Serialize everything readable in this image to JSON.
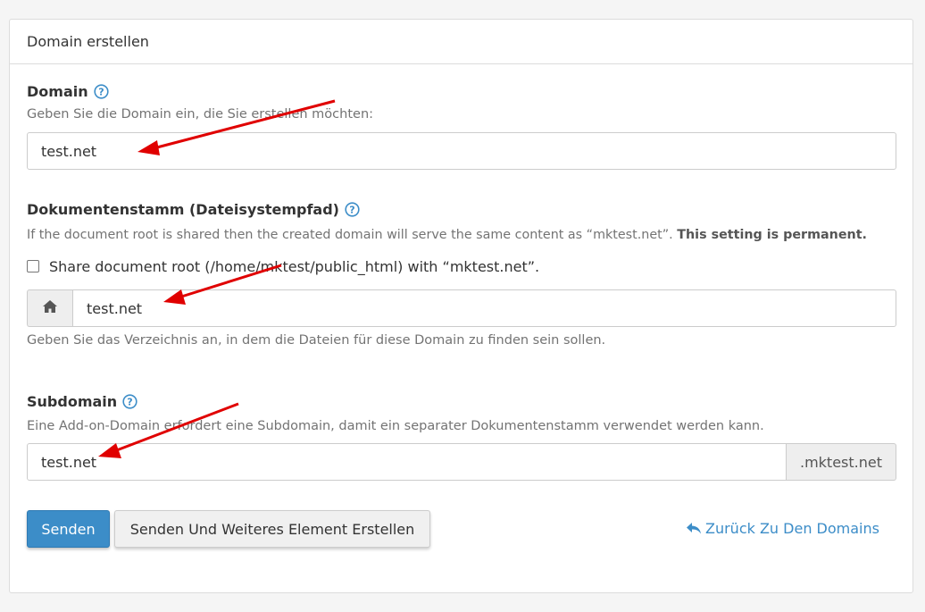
{
  "panel": {
    "title": "Domain erstellen"
  },
  "domain": {
    "label": "Domain",
    "help": "Geben Sie die Domain ein, die Sie erstellen möchten:",
    "value": "test.net"
  },
  "docroot": {
    "label": "Dokumentenstamm (Dateisystempfad)",
    "info": "If the document root is shared then the created domain will serve the same content as “mktest.net”.",
    "info_strong": "This setting is permanent.",
    "share_label": "Share document root (/home/mktest/public_html) with “mktest.net”.",
    "share_checked": false,
    "value": "test.net",
    "help": "Geben Sie das Verzeichnis an, in dem die Dateien für diese Domain zu finden sein sollen."
  },
  "subdomain": {
    "label": "Subdomain",
    "help": "Eine Add-on-Domain erfordert eine Subdomain, damit ein separater Dokumentenstamm verwendet werden kann.",
    "value": "test.net",
    "suffix": ".mktest.net"
  },
  "actions": {
    "submit_label": "Senden",
    "submit_another_label": "Senden Und Weiteres Element Erstellen",
    "back_label": "Zurück Zu Den Domains"
  },
  "colors": {
    "primary": "#3c8dc8",
    "annotation_arrow": "#e00000"
  }
}
